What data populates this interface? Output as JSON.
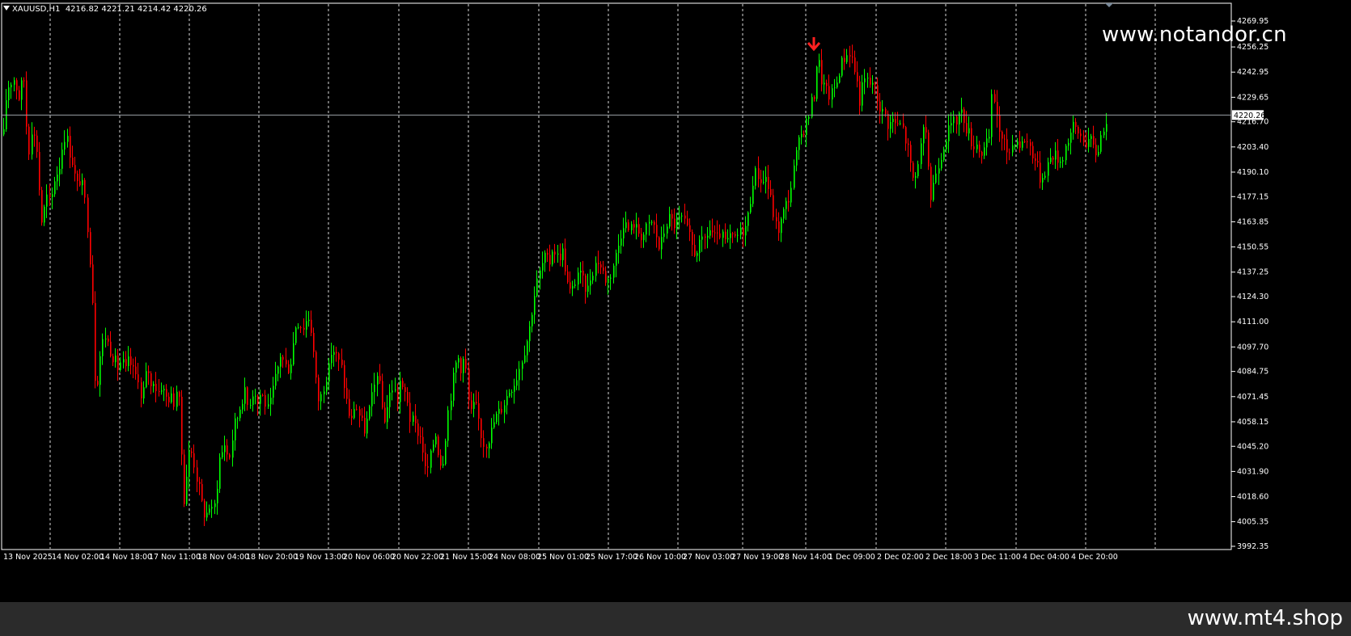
{
  "header": {
    "symbol": "XAUUSD,H1",
    "ohlc": "4216.82 4221.21 4214.42 4220.26"
  },
  "watermarks": {
    "top": "www.notandor.cn",
    "bottom": "www.mt4.shop"
  },
  "colors": {
    "background": "#000000",
    "bull": "#00ff00",
    "bear": "#ff0000",
    "grid": "#ffffff",
    "bid_line": "#9aa0a6",
    "footer": "#2b2b2b"
  },
  "icons": {
    "sell_arrow": "arrow-down-icon",
    "shift_marker": "triangle-down-icon"
  },
  "chart_data": {
    "type": "candlestick",
    "symbol": "XAUUSD",
    "timeframe": "H1",
    "current_price": "4220.26",
    "ylim": [
      3992.35,
      4275
    ],
    "y_ticks": [
      "4269.95",
      "4256.25",
      "4242.95",
      "4229.65",
      "4216.70",
      "4203.40",
      "4190.10",
      "4177.15",
      "4163.85",
      "4150.55",
      "4137.25",
      "4124.30",
      "4111.00",
      "4097.70",
      "4084.75",
      "4071.45",
      "4058.15",
      "4045.20",
      "4031.90",
      "4018.60",
      "4005.35",
      "3992.35"
    ],
    "x_ticks": [
      "13 Nov 2025",
      "14 Nov 02:00",
      "14 Nov 18:00",
      "17 Nov 11:00",
      "18 Nov 04:00",
      "18 Nov 20:00",
      "19 Nov 13:00",
      "20 Nov 06:00",
      "20 Nov 22:00",
      "21 Nov 15:00",
      "24 Nov 08:00",
      "25 Nov 01:00",
      "25 Nov 17:00",
      "26 Nov 10:00",
      "27 Nov 03:00",
      "27 Nov 19:00",
      "28 Nov 14:00",
      "1 Dec 09:00",
      "2 Dec 02:00",
      "2 Dec 18:00",
      "3 Dec 11:00",
      "4 Dec 04:00",
      "4 Dec 20:00"
    ],
    "close_path": [
      [
        0,
        4210
      ],
      [
        4,
        4234
      ],
      [
        9,
        4238
      ],
      [
        14,
        4240
      ],
      [
        18,
        4228
      ],
      [
        22,
        4236
      ],
      [
        26,
        4240
      ],
      [
        30,
        4196
      ],
      [
        34,
        4214
      ],
      [
        38,
        4208
      ],
      [
        42,
        4200
      ],
      [
        46,
        4162
      ],
      [
        50,
        4170
      ],
      [
        54,
        4178
      ],
      [
        58,
        4172
      ],
      [
        62,
        4186
      ],
      [
        66,
        4190
      ],
      [
        70,
        4195
      ],
      [
        74,
        4210
      ],
      [
        78,
        4208
      ],
      [
        82,
        4200
      ],
      [
        86,
        4194
      ],
      [
        90,
        4182
      ],
      [
        94,
        4186
      ],
      [
        98,
        4182
      ],
      [
        102,
        4170
      ],
      [
        106,
        4150
      ],
      [
        110,
        4122
      ],
      [
        114,
        4070
      ],
      [
        118,
        4090
      ],
      [
        122,
        4100
      ],
      [
        126,
        4104
      ],
      [
        130,
        4098
      ],
      [
        134,
        4094
      ],
      [
        138,
        4090
      ],
      [
        142,
        4086
      ],
      [
        146,
        4092
      ],
      [
        150,
        4084
      ],
      [
        154,
        4090
      ],
      [
        158,
        4088
      ],
      [
        162,
        4082
      ],
      [
        166,
        4084
      ],
      [
        170,
        4068
      ],
      [
        174,
        4078
      ],
      [
        178,
        4088
      ],
      [
        182,
        4076
      ],
      [
        186,
        4082
      ],
      [
        190,
        4072
      ],
      [
        194,
        4078
      ],
      [
        198,
        4074
      ],
      [
        202,
        4070
      ],
      [
        206,
        4072
      ],
      [
        210,
        4068
      ],
      [
        214,
        4076
      ],
      [
        218,
        4064
      ],
      [
        222,
        4014
      ],
      [
        226,
        4030
      ],
      [
        230,
        4044
      ],
      [
        234,
        4040
      ],
      [
        238,
        4030
      ],
      [
        242,
        4022
      ],
      [
        246,
        4012
      ],
      [
        250,
        4008
      ],
      [
        254,
        4014
      ],
      [
        258,
        4010
      ],
      [
        262,
        4016
      ],
      [
        266,
        4038
      ],
      [
        270,
        4042
      ],
      [
        274,
        4048
      ],
      [
        278,
        4036
      ],
      [
        282,
        4048
      ],
      [
        286,
        4058
      ],
      [
        290,
        4062
      ],
      [
        294,
        4070
      ],
      [
        298,
        4074
      ],
      [
        302,
        4066
      ],
      [
        306,
        4072
      ],
      [
        310,
        4076
      ],
      [
        314,
        4068
      ],
      [
        318,
        4074
      ],
      [
        322,
        4070
      ],
      [
        326,
        4064
      ],
      [
        330,
        4068
      ],
      [
        334,
        4078
      ],
      [
        338,
        4084
      ],
      [
        342,
        4094
      ],
      [
        346,
        4090
      ],
      [
        350,
        4086
      ],
      [
        354,
        4088
      ],
      [
        358,
        4100
      ],
      [
        362,
        4112
      ],
      [
        366,
        4110
      ],
      [
        370,
        4108
      ],
      [
        374,
        4112
      ],
      [
        378,
        4114
      ],
      [
        382,
        4100
      ],
      [
        386,
        4080
      ],
      [
        390,
        4068
      ],
      [
        394,
        4074
      ],
      [
        398,
        4082
      ],
      [
        402,
        4086
      ],
      [
        406,
        4098
      ],
      [
        410,
        4094
      ],
      [
        414,
        4090
      ],
      [
        418,
        4086
      ],
      [
        422,
        4074
      ],
      [
        426,
        4064
      ],
      [
        430,
        4058
      ],
      [
        434,
        4068
      ],
      [
        438,
        4064
      ],
      [
        442,
        4058
      ],
      [
        446,
        4054
      ],
      [
        450,
        4060
      ],
      [
        454,
        4068
      ],
      [
        458,
        4076
      ],
      [
        462,
        4086
      ],
      [
        466,
        4072
      ],
      [
        470,
        4058
      ],
      [
        474,
        4066
      ],
      [
        478,
        4074
      ],
      [
        482,
        4078
      ],
      [
        486,
        4068
      ],
      [
        490,
        4080
      ],
      [
        494,
        4072
      ],
      [
        498,
        4074
      ],
      [
        502,
        4060
      ],
      [
        506,
        4058
      ],
      [
        510,
        4054
      ],
      [
        514,
        4052
      ],
      [
        518,
        4044
      ],
      [
        522,
        4030
      ],
      [
        526,
        4036
      ],
      [
        530,
        4046
      ],
      [
        534,
        4052
      ],
      [
        538,
        4040
      ],
      [
        542,
        4034
      ],
      [
        546,
        4050
      ],
      [
        550,
        4066
      ],
      [
        554,
        4076
      ],
      [
        558,
        4088
      ],
      [
        562,
        4092
      ],
      [
        566,
        4086
      ],
      [
        570,
        4094
      ],
      [
        574,
        4070
      ],
      [
        578,
        4062
      ],
      [
        582,
        4068
      ],
      [
        586,
        4062
      ],
      [
        590,
        4052
      ],
      [
        594,
        4046
      ],
      [
        598,
        4048
      ],
      [
        602,
        4052
      ],
      [
        606,
        4058
      ],
      [
        610,
        4062
      ],
      [
        614,
        4064
      ],
      [
        618,
        4068
      ],
      [
        622,
        4072
      ],
      [
        626,
        4076
      ],
      [
        630,
        4078
      ],
      [
        634,
        4082
      ],
      [
        638,
        4088
      ],
      [
        642,
        4094
      ],
      [
        646,
        4100
      ],
      [
        650,
        4108
      ],
      [
        654,
        4120
      ],
      [
        658,
        4130
      ],
      [
        662,
        4136
      ],
      [
        666,
        4142
      ],
      [
        670,
        4146
      ],
      [
        674,
        4140
      ],
      [
        678,
        4150
      ],
      [
        682,
        4148
      ],
      [
        686,
        4144
      ],
      [
        690,
        4150
      ],
      [
        694,
        4140
      ],
      [
        698,
        4128
      ],
      [
        702,
        4126
      ],
      [
        706,
        4132
      ],
      [
        710,
        4138
      ],
      [
        714,
        4134
      ],
      [
        718,
        4130
      ],
      [
        722,
        4128
      ],
      [
        726,
        4136
      ],
      [
        730,
        4140
      ],
      [
        734,
        4144
      ],
      [
        738,
        4140
      ],
      [
        742,
        4136
      ],
      [
        746,
        4132
      ],
      [
        750,
        4136
      ],
      [
        754,
        4142
      ],
      [
        758,
        4148
      ],
      [
        762,
        4156
      ],
      [
        766,
        4164
      ],
      [
        770,
        4162
      ],
      [
        774,
        4158
      ],
      [
        778,
        4164
      ],
      [
        782,
        4160
      ],
      [
        786,
        4158
      ],
      [
        790,
        4156
      ],
      [
        794,
        4160
      ],
      [
        798,
        4162
      ],
      [
        802,
        4164
      ],
      [
        806,
        4158
      ],
      [
        810,
        4150
      ],
      [
        814,
        4154
      ],
      [
        818,
        4162
      ],
      [
        822,
        4166
      ],
      [
        826,
        4164
      ],
      [
        830,
        4162
      ],
      [
        834,
        4164
      ],
      [
        838,
        4166
      ],
      [
        842,
        4162
      ],
      [
        846,
        4158
      ],
      [
        850,
        4152
      ],
      [
        854,
        4148
      ],
      [
        858,
        4150
      ],
      [
        862,
        4152
      ],
      [
        866,
        4154
      ],
      [
        870,
        4158
      ],
      [
        874,
        4160
      ],
      [
        878,
        4156
      ],
      [
        882,
        4154
      ],
      [
        886,
        4158
      ],
      [
        890,
        4154
      ],
      [
        894,
        4152
      ],
      [
        898,
        4156
      ],
      [
        902,
        4154
      ],
      [
        906,
        4156
      ],
      [
        910,
        4158
      ],
      [
        914,
        4160
      ],
      [
        918,
        4162
      ],
      [
        922,
        4172
      ],
      [
        926,
        4186
      ],
      [
        930,
        4190
      ],
      [
        934,
        4188
      ],
      [
        938,
        4184
      ],
      [
        942,
        4188
      ],
      [
        946,
        4180
      ],
      [
        950,
        4172
      ],
      [
        954,
        4162
      ],
      [
        958,
        4160
      ],
      [
        962,
        4166
      ],
      [
        966,
        4172
      ],
      [
        970,
        4176
      ],
      [
        974,
        4184
      ],
      [
        978,
        4196
      ],
      [
        982,
        4204
      ],
      [
        986,
        4210
      ],
      [
        990,
        4214
      ],
      [
        994,
        4218
      ],
      [
        998,
        4226
      ],
      [
        1002,
        4232
      ],
      [
        1006,
        4254
      ],
      [
        1010,
        4240
      ],
      [
        1014,
        4236
      ],
      [
        1018,
        4232
      ],
      [
        1022,
        4230
      ],
      [
        1026,
        4234
      ],
      [
        1030,
        4238
      ],
      [
        1034,
        4246
      ],
      [
        1038,
        4250
      ],
      [
        1042,
        4252
      ],
      [
        1046,
        4254
      ],
      [
        1050,
        4248
      ],
      [
        1054,
        4240
      ],
      [
        1058,
        4228
      ],
      [
        1062,
        4236
      ],
      [
        1066,
        4240
      ],
      [
        1070,
        4236
      ],
      [
        1074,
        4238
      ],
      [
        1078,
        4232
      ],
      [
        1082,
        4226
      ],
      [
        1086,
        4222
      ],
      [
        1090,
        4220
      ],
      [
        1094,
        4214
      ],
      [
        1098,
        4218
      ],
      [
        1102,
        4216
      ],
      [
        1106,
        4214
      ],
      [
        1110,
        4216
      ],
      [
        1114,
        4208
      ],
      [
        1118,
        4202
      ],
      [
        1122,
        4190
      ],
      [
        1126,
        4184
      ],
      [
        1130,
        4196
      ],
      [
        1134,
        4204
      ],
      [
        1138,
        4214
      ],
      [
        1142,
        4200
      ],
      [
        1146,
        4176
      ],
      [
        1150,
        4186
      ],
      [
        1154,
        4194
      ],
      [
        1158,
        4198
      ],
      [
        1162,
        4206
      ],
      [
        1166,
        4210
      ],
      [
        1170,
        4214
      ],
      [
        1174,
        4216
      ],
      [
        1178,
        4218
      ],
      [
        1182,
        4222
      ],
      [
        1186,
        4220
      ],
      [
        1190,
        4214
      ],
      [
        1194,
        4210
      ],
      [
        1198,
        4204
      ],
      [
        1202,
        4206
      ],
      [
        1206,
        4202
      ],
      [
        1210,
        4200
      ],
      [
        1214,
        4204
      ],
      [
        1218,
        4206
      ],
      [
        1222,
        4232
      ],
      [
        1226,
        4226
      ],
      [
        1230,
        4214
      ],
      [
        1234,
        4206
      ],
      [
        1238,
        4204
      ],
      [
        1242,
        4200
      ],
      [
        1246,
        4204
      ],
      [
        1250,
        4208
      ],
      [
        1254,
        4206
      ],
      [
        1258,
        4204
      ],
      [
        1262,
        4208
      ],
      [
        1266,
        4206
      ],
      [
        1270,
        4202
      ],
      [
        1274,
        4198
      ],
      [
        1278,
        4192
      ],
      [
        1282,
        4186
      ],
      [
        1286,
        4190
      ],
      [
        1290,
        4194
      ],
      [
        1294,
        4198
      ],
      [
        1298,
        4200
      ],
      [
        1302,
        4198
      ],
      [
        1306,
        4196
      ],
      [
        1310,
        4200
      ],
      [
        1314,
        4206
      ],
      [
        1318,
        4210
      ],
      [
        1322,
        4214
      ],
      [
        1326,
        4212
      ],
      [
        1330,
        4210
      ],
      [
        1334,
        4208
      ],
      [
        1338,
        4206
      ],
      [
        1342,
        4208
      ],
      [
        1346,
        4204
      ],
      [
        1350,
        4200
      ],
      [
        1354,
        4204
      ],
      [
        1358,
        4212
      ],
      [
        1364,
        4220.26
      ]
    ]
  }
}
